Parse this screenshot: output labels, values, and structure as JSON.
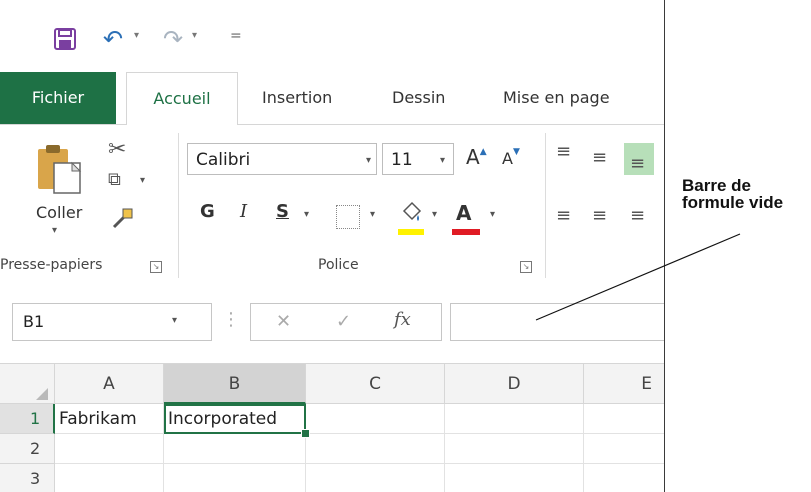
{
  "quick_access": {
    "save_icon": "save-icon",
    "undo_icon": "undo-icon",
    "redo_icon": "redo-icon",
    "customize_icon": "customize-qat-icon",
    "undo_glyph": "↶",
    "redo_glyph": "↷",
    "customize_glyph": "="
  },
  "tabs": [
    {
      "label": "Fichier"
    },
    {
      "label": "Accueil"
    },
    {
      "label": "Insertion"
    },
    {
      "label": "Dessin"
    },
    {
      "label": "Mise en page"
    }
  ],
  "ribbon": {
    "clipboard": {
      "paste_label": "Coller",
      "group_label": "Presse-papiers"
    },
    "font": {
      "font_name": "Calibri",
      "font_size": "11",
      "grow_label": "A",
      "shrink_label": "A",
      "bold_label": "G",
      "italic_label": "I",
      "underline_label": "S",
      "font_color_label": "A",
      "group_label": "Police",
      "fill_color": "#fff200",
      "font_color": "#e01b24"
    },
    "alignment": {
      "highlight_color": "#b7dfb9"
    }
  },
  "formula_bar": {
    "name_box": "B1",
    "fx_label": "fx",
    "cancel_glyph": "✕",
    "enter_glyph": "✓",
    "content": ""
  },
  "grid": {
    "columns": [
      "A",
      "B",
      "C",
      "D",
      "E"
    ],
    "rows": [
      "1",
      "2",
      "3"
    ],
    "cells": {
      "A1": "Fabrikam",
      "B1": "Incorporated"
    },
    "active_cell": "B1"
  },
  "callout": {
    "line1": "Barre de",
    "line2": "formule vide"
  },
  "colors": {
    "file_tab": "#1e7145",
    "accent": "#217346"
  }
}
